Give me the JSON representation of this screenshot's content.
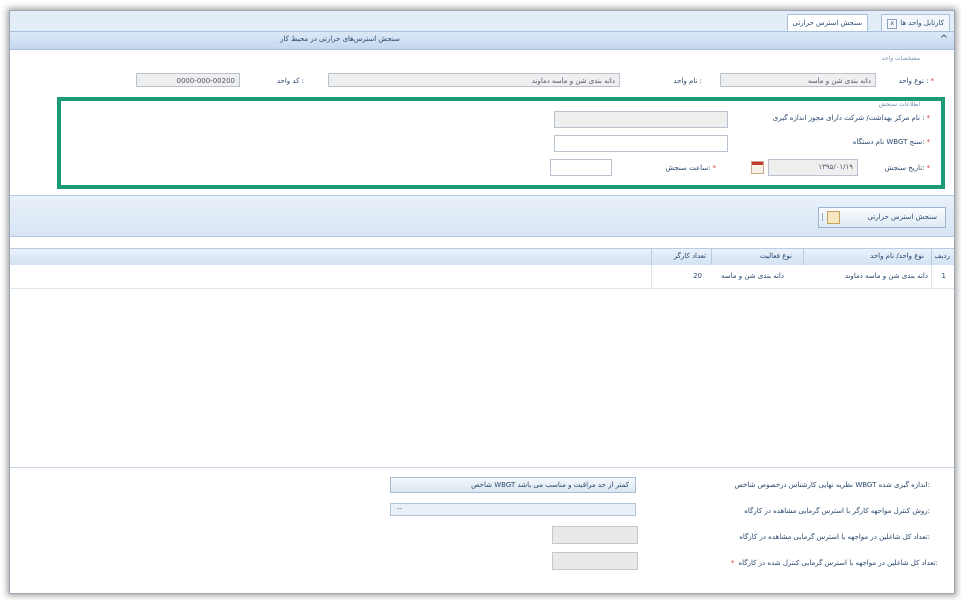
{
  "tabs": [
    {
      "label": "سنجش استرس حرارتی"
    },
    {
      "label": "کارتابل واحد ها"
    }
  ],
  "title": "سنجش استرس‌های حرارتی در محیط کار",
  "unit_section": {
    "legend": "مشخصات واحد",
    "unit_type_label": "نوع واحد :",
    "unit_type_value": "دانه بندی شن و ماسه",
    "unit_name_label": "نام واحد :",
    "unit_name_value": "دانه بندی شن و ماسه دماوند",
    "unit_code_label": "کد واحد :",
    "unit_code_value": "0000-000-00200"
  },
  "measurement_section": {
    "legend": "اطلاعات سنجش",
    "center_label": "نام مرکز بهداشت/ شرکت دارای مجوز اندازه گیری :",
    "center_value": "",
    "device_label": "نام دستگاه WBGT سنج:",
    "device_value": "",
    "date_label": "تاریخ سنجش:",
    "date_value": "۱۳۹۵/۰۱/۱۹",
    "time_label": "ساعت سنجش:",
    "time_value": ""
  },
  "grid": {
    "add_button": "سنجش استرس حرارتی",
    "columns": [
      "ردیف",
      "نوع واحد/ نام واحد",
      "نوع فعالیت",
      "تعداد کارگر"
    ],
    "rows": [
      {
        "index": "1",
        "unit": "دانه بندی شن و ماسه دماوند",
        "activity": "دانه بندی شن و ماسه",
        "workers": "20"
      }
    ]
  },
  "summary": {
    "q1_label": "نظریه نهایی کارشناس درخصوص شاخص WBGT اندازه گیری شده:",
    "q1_value": "شاخص WBGT کمتر از حد مراقبت و مناسب می باشد",
    "q2_label": "روش کنترل مواجهه کارگر با استرس گرمایی مشاهده در کارگاه:",
    "q2_value": "--",
    "q3_label": "تعداد کل شاغلین در مواجهه با استرس گرمایی مشاهده در کارگاه:",
    "q4_label": "تعداد کل شاغلین در مواجهه با استرس گرمایی کنترل شده در کارگاه:"
  }
}
